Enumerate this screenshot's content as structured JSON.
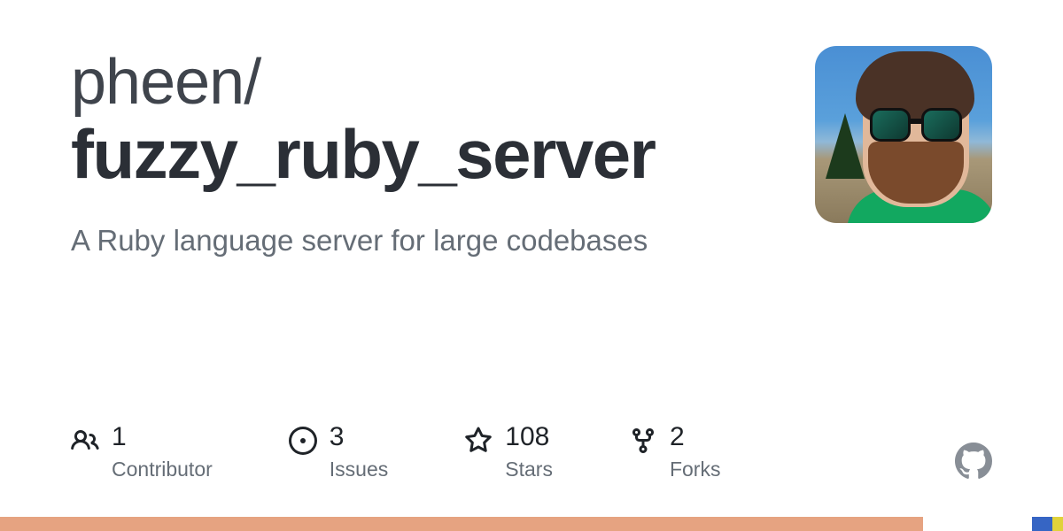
{
  "repo": {
    "owner": "pheen",
    "slash": "/",
    "name": "fuzzy_ruby_server",
    "description": "A Ruby language server for large codebases"
  },
  "stats": {
    "contributors": {
      "value": "1",
      "label": "Contributor"
    },
    "issues": {
      "value": "3",
      "label": "Issues"
    },
    "stars": {
      "value": "108",
      "label": "Stars"
    },
    "forks": {
      "value": "2",
      "label": "Forks"
    }
  },
  "colors": {
    "stripe": [
      {
        "color": "#e6a381",
        "flex": 86.8
      },
      {
        "color": "#ffffff",
        "flex": 10.3
      },
      {
        "color": "#3665c4",
        "flex": 1.9
      },
      {
        "color": "#e0d23a",
        "flex": 1.0
      }
    ]
  }
}
